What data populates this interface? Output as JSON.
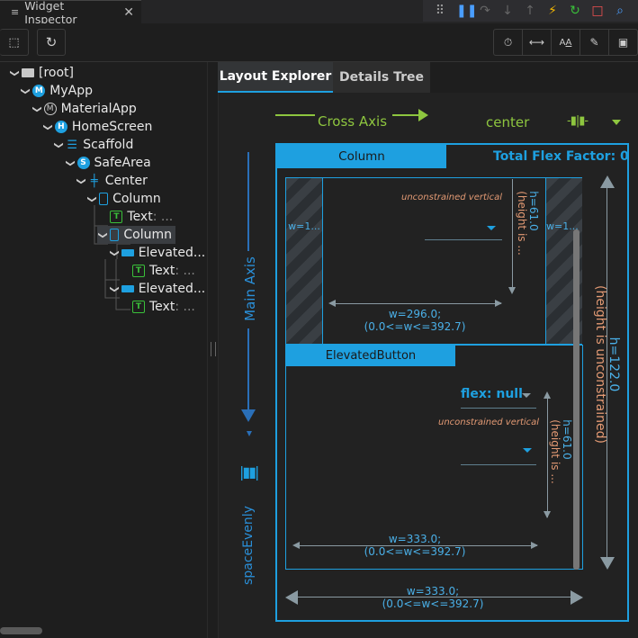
{
  "tab": {
    "icon": "list-icon",
    "title": "Widget Inspector"
  },
  "debug_toolbar": [
    {
      "name": "drag-handle-icon",
      "glyph": "⠿",
      "color": "#999999"
    },
    {
      "name": "pause-icon",
      "glyph": "❚❚",
      "color": "#4a9eff"
    },
    {
      "name": "step-over-icon",
      "glyph": "↷",
      "color": "#666666"
    },
    {
      "name": "step-into-icon",
      "glyph": "↓",
      "color": "#666666"
    },
    {
      "name": "step-out-icon",
      "glyph": "↑",
      "color": "#666666"
    },
    {
      "name": "hot-reload-icon",
      "glyph": "⚡",
      "color": "#f5b800"
    },
    {
      "name": "hot-restart-icon",
      "glyph": "↻",
      "color": "#3ac03a"
    },
    {
      "name": "stop-icon",
      "glyph": "□",
      "color": "#f05050"
    },
    {
      "name": "inspect-icon",
      "glyph": "⌕",
      "color": "#4a9eff"
    }
  ],
  "toolbar": {
    "select_widget_icon": "select-widget-icon",
    "refresh_icon": "refresh-icon",
    "right_icons": [
      "timer-icon",
      "baseline-icon",
      "text-size-icon",
      "paint-icon",
      "image-icon"
    ]
  },
  "tree": [
    {
      "label": "[root]",
      "icon": "folder",
      "depth": 0,
      "chev": "v"
    },
    {
      "label": "MyApp",
      "icon": "circle",
      "letter": "M",
      "depth": 1,
      "chev": "v"
    },
    {
      "label": "MaterialApp",
      "icon": "mcircle",
      "letter": "M",
      "depth": 2,
      "chev": "v"
    },
    {
      "label": "HomeScreen",
      "icon": "circle",
      "letter": "H",
      "depth": 3,
      "chev": "v"
    },
    {
      "label": "Scaffold",
      "icon": "blue",
      "letter": "☰",
      "depth": 4,
      "chev": "v"
    },
    {
      "label": "SafeArea",
      "icon": "circle",
      "letter": "S",
      "depth": 5,
      "chev": "v"
    },
    {
      "label": "Center",
      "icon": "blue",
      "letter": "╪",
      "depth": 6,
      "chev": "v"
    },
    {
      "label": "Column",
      "icon": "col",
      "depth": 7,
      "chev": "v"
    },
    {
      "label": "Text",
      "suffix": ": ...",
      "icon": "text",
      "letter": "T",
      "depth": 8,
      "chev": ""
    },
    {
      "label": "Column",
      "icon": "col",
      "depth": 8,
      "chev": "v",
      "selected": true
    },
    {
      "label": "Elevated...",
      "icon": "btn",
      "depth": 9,
      "chev": "v"
    },
    {
      "label": "Text",
      "suffix": ": ...",
      "icon": "text",
      "letter": "T",
      "depth": 10,
      "chev": ""
    },
    {
      "label": "Elevated...",
      "icon": "btn",
      "depth": 9,
      "chev": "v"
    },
    {
      "label": "Text",
      "suffix": ": ...",
      "icon": "text",
      "letter": "T",
      "depth": 10,
      "chev": ""
    }
  ],
  "right_tabs": [
    "Layout Explorer",
    "Details Tree"
  ],
  "layout": {
    "cross_axis_label": "Cross Axis",
    "cross_axis_value": "center",
    "main_axis_label": "Main Axis",
    "main_axis_value": "spaceEvenly",
    "column_header": "Column",
    "total_flex": "Total Flex Factor: 0",
    "child1": {
      "left_w": "w=1...",
      "right_w": "w=1...",
      "unconstrained": "unconstrained vertical",
      "h_label": "h=61.0",
      "h_note": "(height is ...",
      "w_label": "w=296.0;",
      "w_range": "(0.0<=w<=392.7)"
    },
    "child2": {
      "header": "ElevatedButton",
      "flex": "flex: null",
      "unconstrained": "unconstrained vertical",
      "h_label": "h=61.0",
      "h_note": "(height is ...",
      "w_label": "w=333.0;",
      "w_range": "(0.0<=w<=392.7)"
    },
    "outer_h_label": "h=122.0",
    "outer_h_note": "(height is unconstrained)",
    "outer_w_label": "w=333.0;",
    "outer_w_range": "(0.0<=w<=392.7)"
  },
  "colors": {
    "accent": "#1ea0e0",
    "green": "#8ec63f",
    "orange": "#e39a74"
  }
}
